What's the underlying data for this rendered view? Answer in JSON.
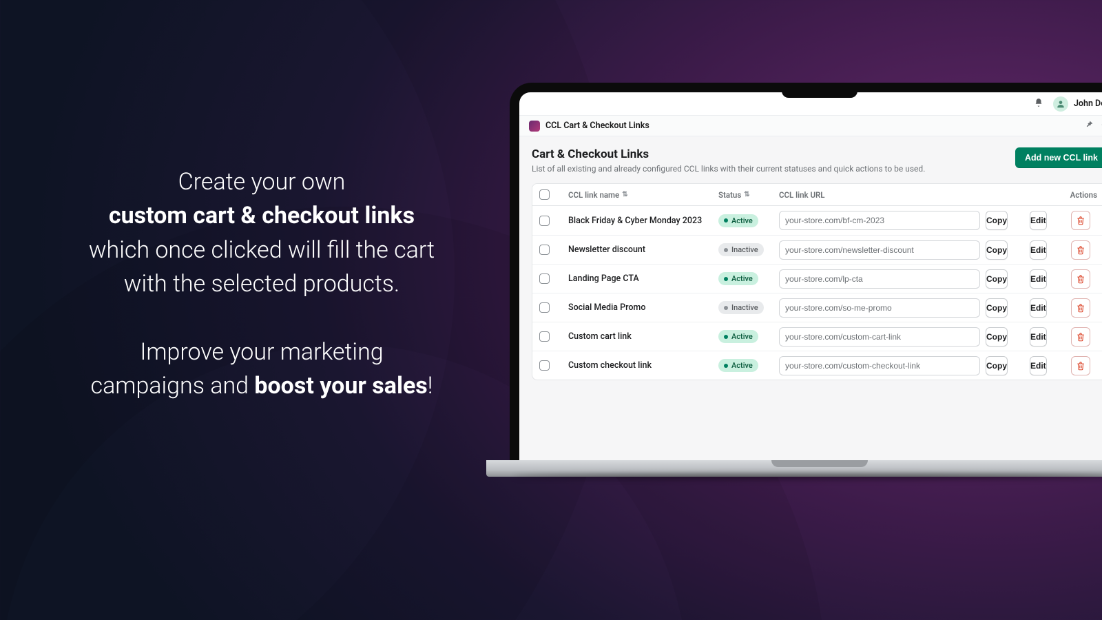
{
  "marketing": {
    "line1": "Create your own",
    "line2_strong": "custom cart & checkout links",
    "line3": "which once clicked will fill the cart",
    "line4": "with the selected products.",
    "line5": "Improve your marketing",
    "line6_pre": "campaigns and ",
    "line6_strong": "boost your sales",
    "line6_post": "!"
  },
  "topbar": {
    "user_name": "John Doe"
  },
  "approw": {
    "title": "CCL Cart & Checkout Links"
  },
  "page": {
    "title": "Cart & Checkout Links",
    "subtitle": "List of all existing and already configured CCL links with their current statuses and quick actions to be used.",
    "add_button": "Add new CCL link"
  },
  "columns": {
    "name": "CCL link name",
    "status": "Status",
    "url": "CCL link URL",
    "actions": "Actions"
  },
  "labels": {
    "copy": "Copy",
    "edit": "Edit",
    "status_active": "Active",
    "status_inactive": "Inactive"
  },
  "rows": [
    {
      "name": "Black Friday & Cyber Monday 2023",
      "status": "active",
      "url": "your-store.com/bf-cm-2023"
    },
    {
      "name": "Newsletter discount",
      "status": "inactive",
      "url": "your-store.com/newsletter-discount"
    },
    {
      "name": "Landing Page CTA",
      "status": "active",
      "url": "your-store.com/lp-cta"
    },
    {
      "name": "Social Media Promo",
      "status": "inactive",
      "url": "your-store.com/so-me-promo"
    },
    {
      "name": "Custom cart link",
      "status": "active",
      "url": "your-store.com/custom-cart-link"
    },
    {
      "name": "Custom checkout link",
      "status": "active",
      "url": "your-store.com/custom-checkout-link"
    }
  ],
  "colors": {
    "accent_green": "#008060",
    "danger_red": "#d72c0d"
  }
}
